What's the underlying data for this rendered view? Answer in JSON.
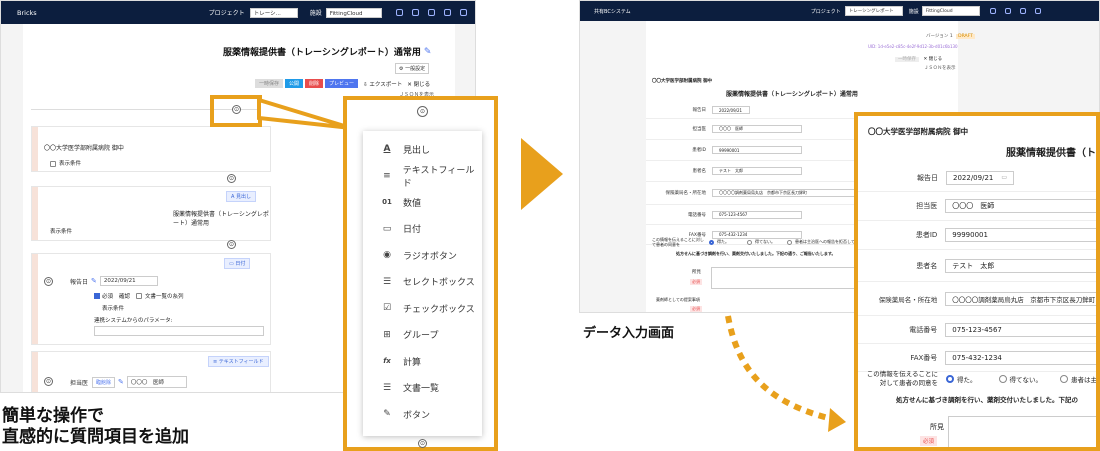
{
  "left": {
    "app_name": "Bricks",
    "project_label": "プロジェクト",
    "project_value": "トレーシ...",
    "facility_label": "施設",
    "facility_value": "FittingCloud",
    "form_title": "服薬情報提供書（トレーシングレポート）通常用",
    "settings_btn": "一般設定",
    "btn_temp": "一時保存",
    "btn_publish": "公開",
    "btn_delete": "削除",
    "btn_preview": "プレビュー",
    "btn_export": "エクスポート",
    "btn_close": "閉じる",
    "json_link": "ＪＳＯＮを表示",
    "block1_text": "〇〇大学医学部附属病院 御中",
    "block1_cond": "表示条件",
    "block2_chip": "見出し",
    "block2_text": "服薬情報提供書（トレーシングレポート）通常用",
    "block2_cond": "表示条件",
    "block3_chip": "日付",
    "block3_label": "報告日",
    "block3_value": "2022/09/21",
    "block3_required": "必須",
    "block3_confirm": "確認",
    "block3_doclist": "文書一覧の糸列",
    "block3_cond": "表示条件",
    "block3_param": "連携システムからのパラメータ:",
    "block4_chip": "テキストフィールド",
    "block4_label": "担当医",
    "block4_tag": "臨館除",
    "block4_value": "〇〇〇　医師",
    "partial_1": "通常",
    "partial_2": "列",
    "caption_line1": "簡単な操作で",
    "caption_line2": "直感的に質問項目を追加"
  },
  "menu": {
    "items": [
      {
        "icon": "A",
        "label": "見出し"
      },
      {
        "icon": "≡",
        "label": "テキストフィールド"
      },
      {
        "icon": "01",
        "label": "数値"
      },
      {
        "icon": "▭",
        "label": "日付"
      },
      {
        "icon": "◉",
        "label": "ラジオボタン"
      },
      {
        "icon": "☰",
        "label": "セレクトボックス"
      },
      {
        "icon": "☑",
        "label": "チェックボックス"
      },
      {
        "icon": "⊞",
        "label": "グループ"
      },
      {
        "icon": "fx",
        "label": "計算"
      },
      {
        "icon": "☰",
        "label": "文書一覧"
      },
      {
        "icon": "✎",
        "label": "ボタン"
      }
    ]
  },
  "right": {
    "app_name": "共有BCシステム",
    "project_label": "プロジェクト",
    "project_value": "トレーシングレポート",
    "facility_label": "施設",
    "facility_value": "FittingCloud",
    "version": "バージョン 1",
    "version_badge": "DRAFT",
    "uid": "UID: 1d-e5e2-c85c-4e2f-9d12-3b-d01c6b130",
    "btn_temp": "一時保存",
    "btn_close": "閉じる",
    "json_link": "ＪＳＯＮを表示",
    "org": "〇〇大学医学部附属病院 御中",
    "doc_title": "服薬情報提供書（トレーシングレポート）通常用",
    "rows": [
      {
        "label": "報告日",
        "value": "2022/09/21"
      },
      {
        "label": "担当医",
        "value": "〇〇〇　医師"
      },
      {
        "label": "患者ID",
        "value": "99990001"
      },
      {
        "label": "患者名",
        "value": "テスト　太郎"
      },
      {
        "label": "保険薬局名・所在地",
        "value": "〇〇〇〇調剤薬局烏丸店　京都市下京区長刀鉾町"
      },
      {
        "label": "電話番号",
        "value": "075-123-4567"
      },
      {
        "label": "FAX番号",
        "value": "075-432-1234"
      }
    ],
    "consent_label": "この情報を伝えることに対して患者の同意を",
    "consent_opt1": "得た。",
    "consent_opt2": "得てない。",
    "consent_opt3": "患者は主治医への報告を拒否していますが…",
    "notice": "処方せんに基づき調剤を行い、薬剤交付いたしました。下記の通り、ご報告いたします。",
    "finding_label": "所見",
    "required": "必須",
    "advice_label": "薬剤師としての提案事項",
    "caption": "データ入力画面"
  },
  "zoom": {
    "org": "〇〇大学医学部附属病院 御中",
    "title": "服薬情報提供書（トレ",
    "rows": [
      {
        "label": "報告日",
        "value": "2022/09/21"
      },
      {
        "label": "担当医",
        "value": "〇〇〇　医師"
      },
      {
        "label": "患者ID",
        "value": "99990001"
      },
      {
        "label": "患者名",
        "value": "テスト　太郎"
      },
      {
        "label": "保険薬局名・所在地",
        "value": "〇〇〇〇調剤薬局烏丸店　京都市下京区長刀鉾町"
      },
      {
        "label": "電話番号",
        "value": "075-123-4567"
      },
      {
        "label": "FAX番号",
        "value": "075-432-1234"
      }
    ],
    "consent_label": "この情報を伝えることに対して患者の同意を",
    "opt1": "得た。",
    "opt2": "得てない。",
    "opt3": "患者は主治医",
    "notice": "処方せんに基づき調剤を行い、薬剤交付いたしました。下記の",
    "finding_label": "所見",
    "required": "必須"
  },
  "colors": {
    "orange": "#e8a01c",
    "navy": "#0c1e3e",
    "publish": "#1f9be8",
    "delete": "#e84d4d",
    "preview": "#4f76ef"
  }
}
